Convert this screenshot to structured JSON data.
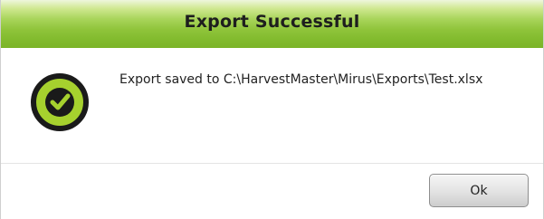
{
  "dialog": {
    "title": "Export Successful",
    "message": "Export saved to C:\\HarvestMaster\\Mirus\\Exports\\Test.xlsx",
    "icon": "checkmark-circle-icon",
    "ok_label": "Ok"
  },
  "colors": {
    "title_bar_green": "#8fc43a",
    "icon_green": "#a6d12e",
    "icon_dark": "#1a1a1a"
  }
}
